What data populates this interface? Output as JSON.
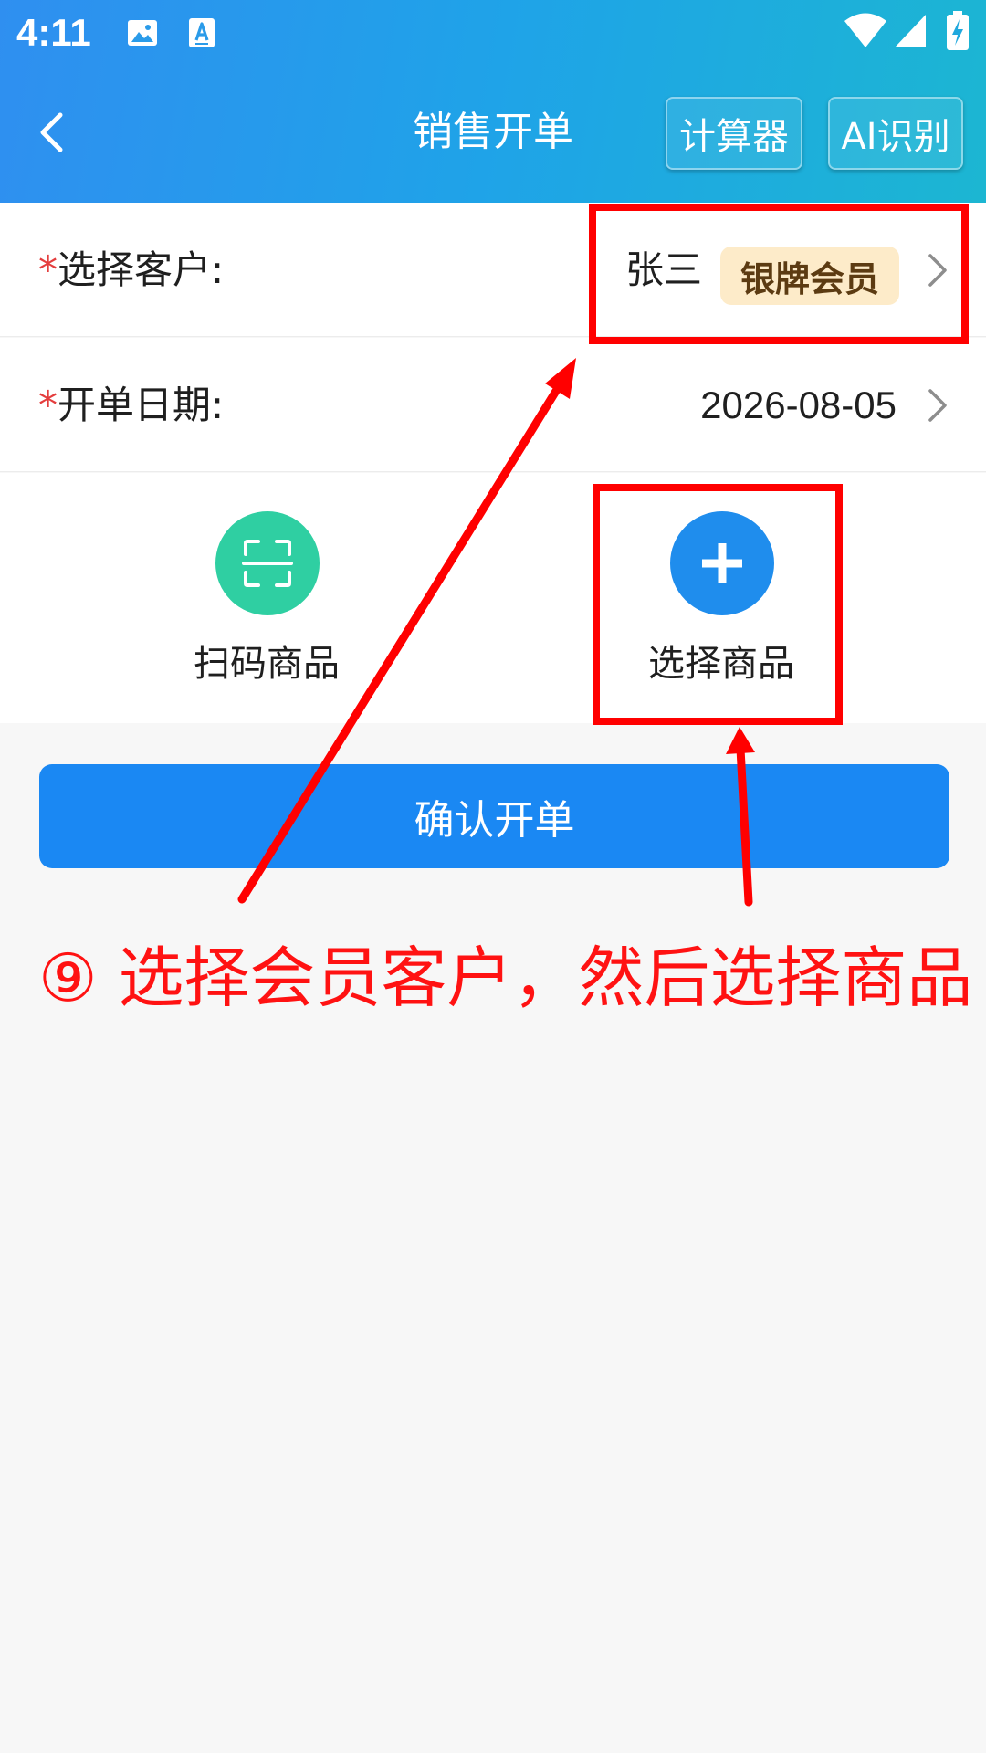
{
  "status_bar": {
    "time": "4:11",
    "icons": [
      "image-icon",
      "text-recognition-icon",
      "wifi-icon",
      "signal-icon",
      "battery-charging-icon"
    ]
  },
  "nav": {
    "back_icon": "chevron-left-icon",
    "title": "销售开单",
    "calculator_label": "计算器",
    "ai_label": "AI识别"
  },
  "form": {
    "customer": {
      "required_mark": "*",
      "label": "选择客户:",
      "name": "张三",
      "member_level": "银牌会员"
    },
    "date": {
      "required_mark": "*",
      "label": "开单日期:",
      "value": "2026-08-05"
    }
  },
  "actions": {
    "scan": {
      "label": "扫码商品",
      "icon": "scan-icon"
    },
    "select": {
      "label": "选择商品",
      "icon": "plus-icon"
    }
  },
  "confirm_label": "确认开单",
  "annotation": {
    "text": "⑨ 选择会员客户，然后选择商品",
    "color": "#ff0000"
  },
  "colors": {
    "header_gradient_start": "#2f8ff0",
    "header_gradient_end": "#1cb6d2",
    "primary_button": "#1a88f3",
    "scan_circle": "#2fcfa2",
    "select_circle": "#1f8ded",
    "badge_background": "#fdebc9",
    "required_star": "#e43d3d"
  }
}
